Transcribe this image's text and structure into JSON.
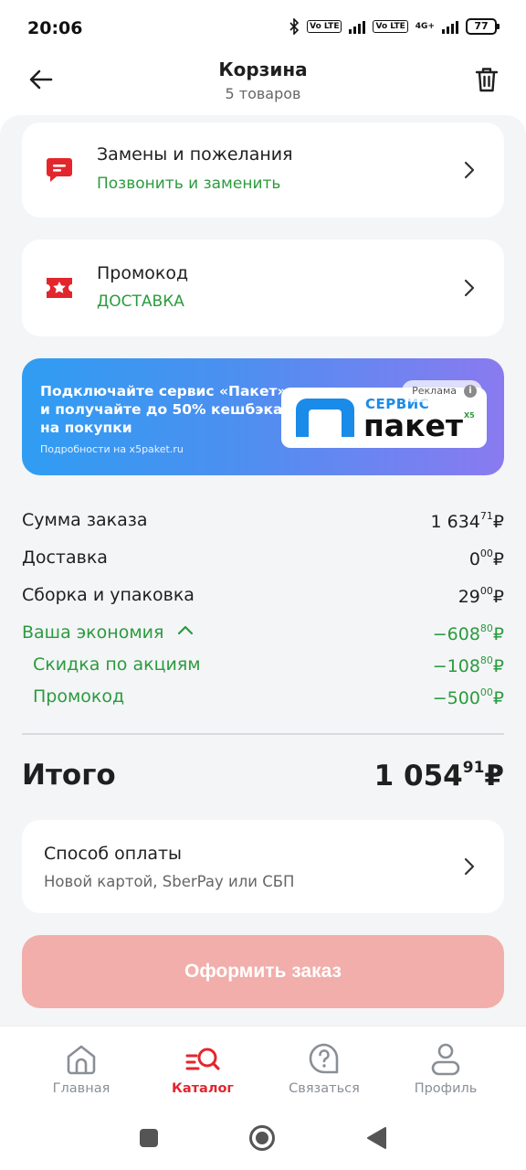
{
  "status_bar": {
    "time": "20:06",
    "battery": "77",
    "network_1": "Vo LTE",
    "network_2": "Vo LTE",
    "network_type": "4G+"
  },
  "header": {
    "title": "Корзина",
    "subtitle": "5 товаров"
  },
  "cards": {
    "replacements": {
      "title": "Замены и пожелания",
      "subtitle": "Позвонить и заменить"
    },
    "promocode": {
      "title": "Промокод",
      "subtitle": "ДОСТАВКА"
    }
  },
  "banner": {
    "text": "Подключайте сервис «Пакет» и получайте до 50% кешбэка на покупки",
    "small": "Подробности на x5paket.ru",
    "logo_top": "СЕРВИС",
    "logo_main": "пакет",
    "logo_brand": "X5",
    "ad_label": "Реклама"
  },
  "summary": {
    "order_sum": {
      "label": "Сумма заказа",
      "rub": "1 634",
      "kop": "71",
      "cur": "₽"
    },
    "delivery": {
      "label": "Доставка",
      "rub": "0",
      "kop": "00",
      "cur": "₽"
    },
    "assembly": {
      "label": "Сборка и упаковка",
      "rub": "29",
      "kop": "00",
      "cur": "₽"
    },
    "economy": {
      "label": "Ваша экономия",
      "rub": "−608",
      "kop": "80",
      "cur": "₽"
    },
    "discount": {
      "label": "Скидка по акциям",
      "rub": "−108",
      "kop": "80",
      "cur": "₽"
    },
    "promo": {
      "label": "Промокод",
      "rub": "−500",
      "kop": "00",
      "cur": "₽"
    }
  },
  "total": {
    "label": "Итого",
    "rub": "1 054",
    "kop": "91",
    "cur": "₽"
  },
  "payment": {
    "title": "Способ оплаты",
    "subtitle": "Новой картой, SberPay или СБП"
  },
  "order_button": "Оформить заказ",
  "nav": {
    "home": "Главная",
    "catalog": "Каталог",
    "contact": "Связаться",
    "profile": "Профиль"
  },
  "colors": {
    "accent_red": "#e3262d",
    "green": "#2b9b3e",
    "button_disabled": "#f2aeaa"
  }
}
